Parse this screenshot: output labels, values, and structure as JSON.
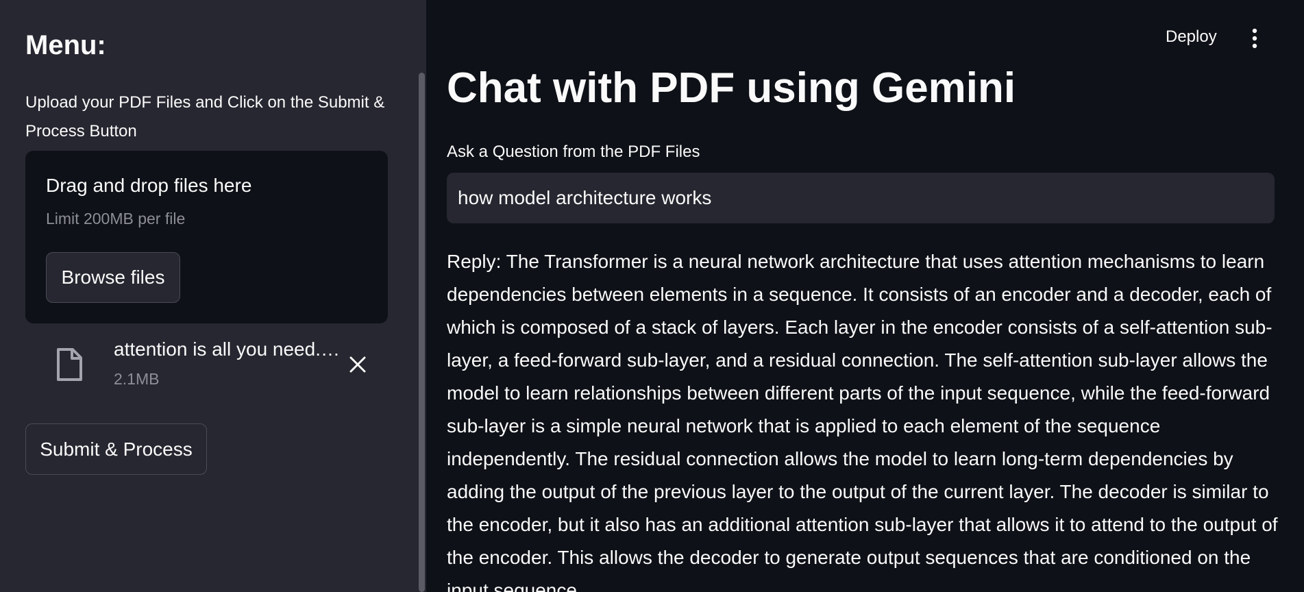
{
  "sidebar": {
    "title": "Menu:",
    "caption": "Upload your PDF Files and Click on the Submit & Process Button",
    "dropzone": {
      "title": "Drag and drop files here",
      "limit": "Limit 200MB per file",
      "browse_label": "Browse files"
    },
    "file": {
      "name": "attention is all you need.pdf",
      "size": "2.1MB",
      "icon": "file-icon",
      "remove_icon": "close-icon"
    },
    "submit_label": "Submit & Process"
  },
  "header": {
    "deploy_label": "Deploy",
    "menu_icon": "kebab-menu-icon"
  },
  "main": {
    "title": "Chat with PDF using Gemini",
    "question_label": "Ask a Question from the PDF Files",
    "question_value": "how model architecture works",
    "reply": "Reply: The Transformer is a neural network architecture that uses attention mechanisms to learn dependencies between elements in a sequence. It consists of an encoder and a decoder, each of which is composed of a stack of layers. Each layer in the encoder consists of a self-attention sub-layer, a feed-forward sub-layer, and a residual connection. The self-attention sub-layer allows the model to learn relationships between different parts of the input sequence, while the feed-forward sub-layer is a simple neural network that is applied to each element of the sequence independently. The residual connection allows the model to learn long-term dependencies by adding the output of the previous layer to the output of the current layer. The decoder is similar to the encoder, but it also has an additional attention sub-layer that allows it to attend to the output of the encoder. This allows the decoder to generate output sequences that are conditioned on the input sequence."
  },
  "colors": {
    "sidebar_bg": "#262730",
    "main_bg": "#0e1117",
    "input_bg": "#262730",
    "text": "#fafafa",
    "muted_text": "#8d8e96"
  }
}
